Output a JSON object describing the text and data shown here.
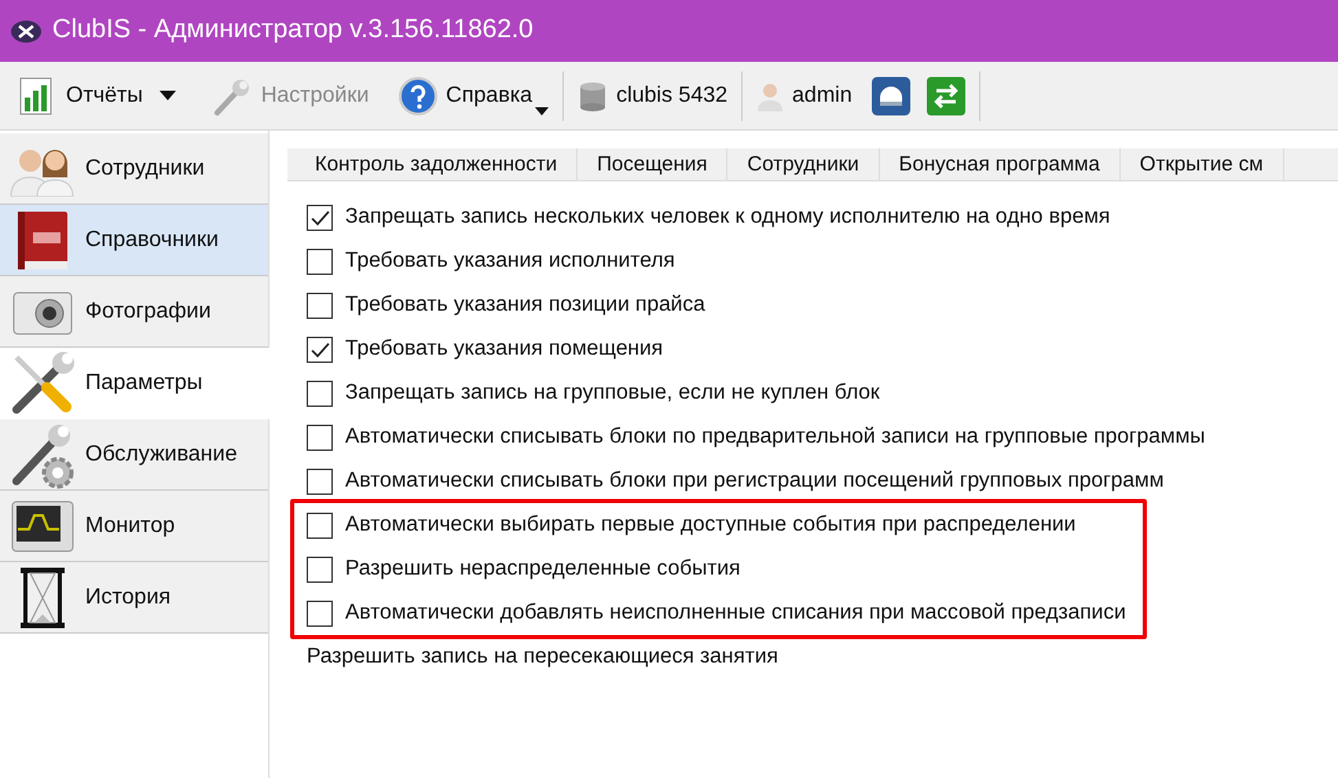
{
  "window": {
    "title": "ClubIS - Администратор v.3.156.11862.0"
  },
  "toolbar": [
    {
      "kind": "reports",
      "label": "Отчёты",
      "disabled": false
    },
    {
      "kind": "settings",
      "label": "Настройки",
      "disabled": true
    },
    {
      "kind": "help",
      "label": "Справка",
      "disabled": false
    },
    {
      "kind": "database",
      "label": "clubis 5432",
      "disabled": false
    },
    {
      "kind": "user",
      "label": "admin",
      "disabled": false
    }
  ],
  "sidebar": {
    "items": [
      {
        "kind": "people",
        "label": "Сотрудники",
        "selected": false,
        "highlighted": false
      },
      {
        "kind": "book",
        "label": "Справочники",
        "selected": false,
        "highlighted": true
      },
      {
        "kind": "camera",
        "label": "Фотографии",
        "selected": false,
        "highlighted": false
      },
      {
        "kind": "tools",
        "label": "Параметры",
        "selected": true,
        "highlighted": false
      },
      {
        "kind": "service",
        "label": "Обслуживание",
        "selected": false,
        "highlighted": false
      },
      {
        "kind": "monitor",
        "label": "Монитор",
        "selected": false,
        "highlighted": false
      },
      {
        "kind": "hourglass",
        "label": "История",
        "selected": false,
        "highlighted": false
      }
    ]
  },
  "tabs": [
    {
      "label": "Контроль задолженности"
    },
    {
      "label": "Посещения"
    },
    {
      "label": "Сотрудники"
    },
    {
      "label": "Бонусная программа"
    },
    {
      "label": "Открытие см"
    }
  ],
  "options": [
    {
      "kind": "checkbox",
      "label": "Запрещать запись нескольких человек к одному исполнителю на одно время",
      "checked": true
    },
    {
      "kind": "checkbox",
      "label": "Требовать указания исполнителя",
      "checked": false
    },
    {
      "kind": "checkbox",
      "label": "Требовать указания позиции прайса",
      "checked": false
    },
    {
      "kind": "checkbox",
      "label": "Требовать указания помещения",
      "checked": true
    },
    {
      "kind": "checkbox",
      "label": "Запрещать запись на групповые, если не куплен блок",
      "checked": false
    },
    {
      "kind": "checkbox",
      "label": "Автоматически списывать блоки по предварительной записи на групповые программы",
      "checked": false
    },
    {
      "kind": "checkbox",
      "label": "Автоматически списывать блоки при регистрации посещений групповых программ",
      "checked": false
    },
    {
      "kind": "outlined_group",
      "children": [
        {
          "kind": "checkbox",
          "label": "Автоматически выбирать первые доступные события при распределении",
          "checked": false
        },
        {
          "kind": "checkbox",
          "label": "Разрешить нераспределенные события",
          "checked": false
        },
        {
          "kind": "checkbox",
          "label": "Автоматически добавлять неисполненные списания при массовой предзаписи",
          "checked": false
        }
      ]
    },
    {
      "kind": "label",
      "label": "Разрешить запись на пересекающиеся занятия"
    }
  ]
}
